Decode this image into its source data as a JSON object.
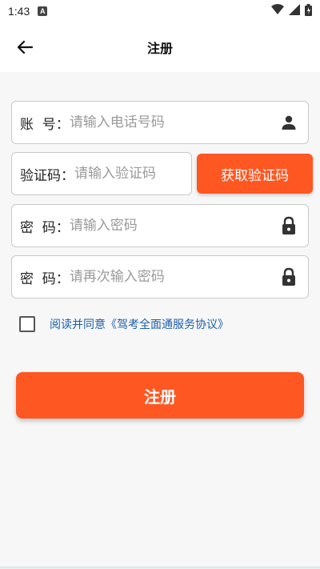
{
  "status_bar": {
    "time": "1:43",
    "a_icon": "A"
  },
  "app_bar": {
    "title": "注册"
  },
  "account": {
    "label": "账  号：",
    "placeholder": "请输入电话号码"
  },
  "code": {
    "label": "验证码：",
    "placeholder": "请输入验证码",
    "button": "获取验证码"
  },
  "password": {
    "label": "密  码：",
    "placeholder": "请输入密码"
  },
  "password_confirm": {
    "label": "密  码：",
    "placeholder": "请再次输入密码"
  },
  "agreement": {
    "text": "阅读并同意《驾考全面通服务协议》"
  },
  "submit": {
    "label": "注册"
  },
  "colors": {
    "accent": "#ff5722",
    "link": "#1e5fa8"
  }
}
